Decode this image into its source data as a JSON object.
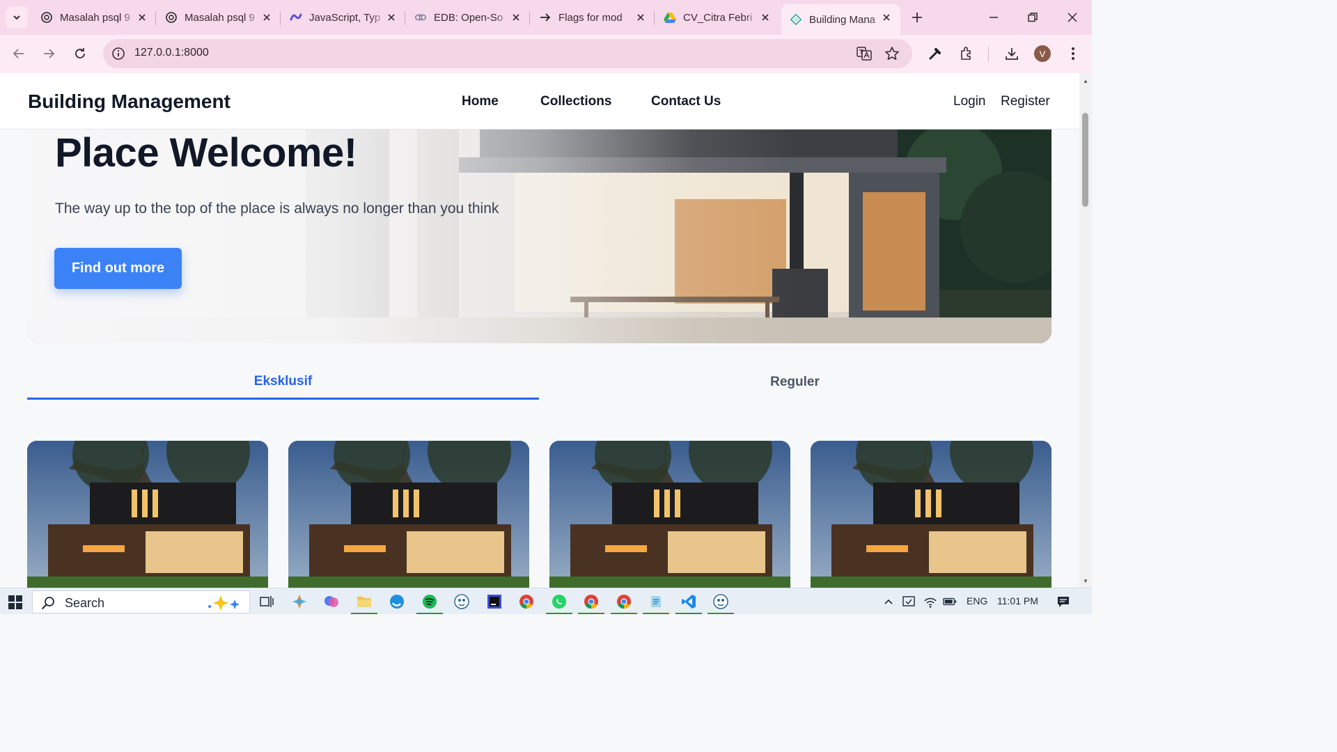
{
  "browser": {
    "tabs": [
      {
        "title": "Masalah psql 9",
        "icon": "openai-icon"
      },
      {
        "title": "Masalah psql 9",
        "icon": "openai-icon"
      },
      {
        "title": "JavaScript, Typ",
        "icon": "copilot-icon"
      },
      {
        "title": "EDB: Open-So",
        "icon": "edb-icon"
      },
      {
        "title": "Flags for mod",
        "icon": "arrow-icon"
      },
      {
        "title": "CV_Citra Febri",
        "icon": "google-drive-icon"
      },
      {
        "title": "Building Mana",
        "icon": "site-icon"
      }
    ],
    "url": "127.0.0.1:8000",
    "profile_initial": "V"
  },
  "site": {
    "brand": "Building Management",
    "nav": {
      "home": "Home",
      "collections": "Collections",
      "contact": "Contact Us"
    },
    "auth": {
      "login": "Login",
      "register": "Register"
    },
    "hero": {
      "title": "Place Welcome!",
      "subtitle": "The way up to the top of the place is always no longer than you think",
      "button": "Find out more"
    },
    "tabs": {
      "exclusive": "Eksklusif",
      "regular": "Reguler"
    },
    "colors": {
      "accent": "#3b82f6",
      "tab_active": "#2563eb"
    }
  },
  "taskbar": {
    "search_placeholder": "Search",
    "lang": "ENG",
    "time": "11:01 PM"
  }
}
